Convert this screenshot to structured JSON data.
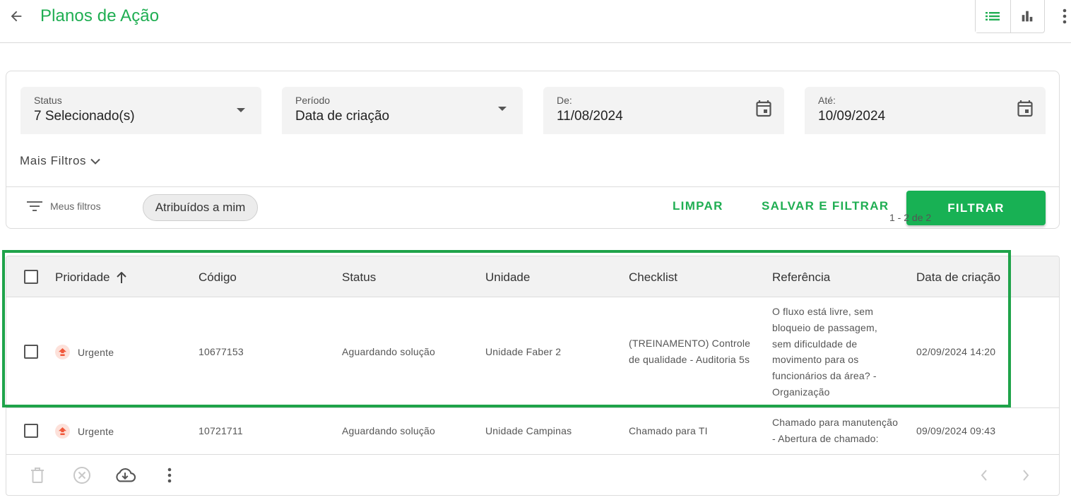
{
  "header": {
    "title": "Planos de Ação"
  },
  "filters": {
    "status": {
      "label": "Status",
      "value": "7 Selecionado(s)"
    },
    "period": {
      "label": "Período",
      "value": "Data de criação"
    },
    "from": {
      "label": "De:",
      "value": "11/08/2024"
    },
    "to": {
      "label": "Até:",
      "value": "10/09/2024"
    },
    "more_filters": "Mais Filtros",
    "my_filters": "Meus filtros",
    "chip": "Atribuídos a mim",
    "clear": "LIMPAR",
    "save_and_filter": "SALVAR E FILTRAR",
    "filter": "FILTRAR"
  },
  "table": {
    "columns": [
      "Prioridade",
      "Código",
      "Status",
      "Unidade",
      "Checklist",
      "Referência",
      "Data de criação"
    ],
    "rows": [
      {
        "priority": "Urgente",
        "code": "10677153",
        "status": "Aguardando solução",
        "unit": "Unidade Faber 2",
        "checklist": [
          "(TREINAMENTO) Controle",
          "de qualidade -  Auditoria 5s"
        ],
        "reference": [
          "O fluxo está livre, sem",
          "bloqueio de passagem,",
          "sem dificuldade de",
          "movimento para os",
          "funcionários da área? -",
          "Organização"
        ],
        "created": "02/09/2024 14:20"
      },
      {
        "priority": "Urgente",
        "code": "10721711",
        "status": "Aguardando solução",
        "unit": "Unidade Campinas",
        "checklist": [
          "Chamado para TI"
        ],
        "reference": [
          "Chamado para manutenção",
          "- Abertura de chamado:"
        ],
        "created": "09/09/2024 09:43"
      }
    ],
    "pagination": "1 - 2 de 2"
  },
  "colors": {
    "accent": "#1fae52",
    "primary_button": "#18b154",
    "urgent_icon": "#f0573a",
    "highlight_border": "#1fa34a"
  },
  "icons": {
    "back": "arrow-left-icon",
    "list_view": "list-icon",
    "chart_view": "bar-chart-icon",
    "menu": "more-vertical-icon",
    "dropdown": "caret-down-icon",
    "calendar": "calendar-icon",
    "chevron": "chevron-down-icon",
    "filter": "filter-lines-icon",
    "priority": "priority-up-icon",
    "sort": "arrow-up-icon",
    "delete": "trash-icon",
    "cancel": "cancel-circle-icon",
    "download": "cloud-download-icon",
    "prev": "chevron-left-icon",
    "next": "chevron-right-icon"
  }
}
